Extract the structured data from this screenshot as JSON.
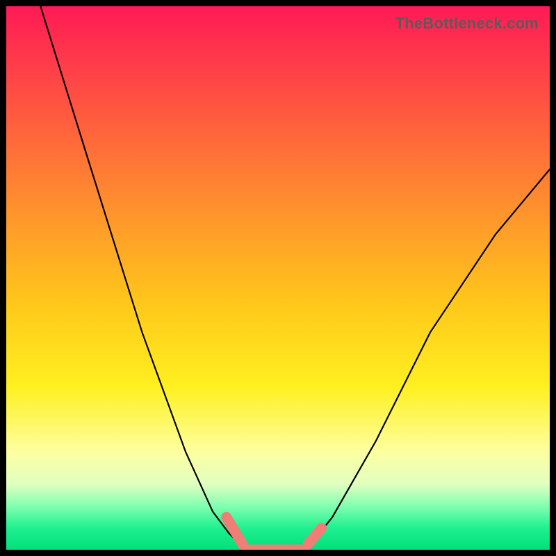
{
  "watermark": "TheBottleneck.com",
  "chart_data": {
    "type": "line",
    "title": "",
    "xlabel": "",
    "ylabel": "",
    "xlim": [
      0,
      100
    ],
    "ylim": [
      0,
      100
    ],
    "series": [
      {
        "name": "black-curve",
        "color": "#000000",
        "x": [
          6,
          15,
          25,
          33,
          38,
          41,
          43,
          47,
          50,
          53,
          56,
          60,
          68,
          78,
          90,
          100
        ],
        "values": [
          101,
          72,
          40,
          18,
          7,
          3,
          1,
          0,
          0,
          0,
          1,
          6,
          20,
          40,
          58,
          70
        ]
      },
      {
        "name": "salmon-segments",
        "color": "#ef7f76",
        "segments": [
          {
            "x": [
              40.5,
              43.5
            ],
            "values": [
              6,
              1
            ]
          },
          {
            "x": [
              44.5,
              54.5
            ],
            "values": [
              0,
              0
            ]
          },
          {
            "x": [
              55.5,
              58.0
            ],
            "values": [
              1,
              4
            ]
          }
        ]
      }
    ]
  }
}
